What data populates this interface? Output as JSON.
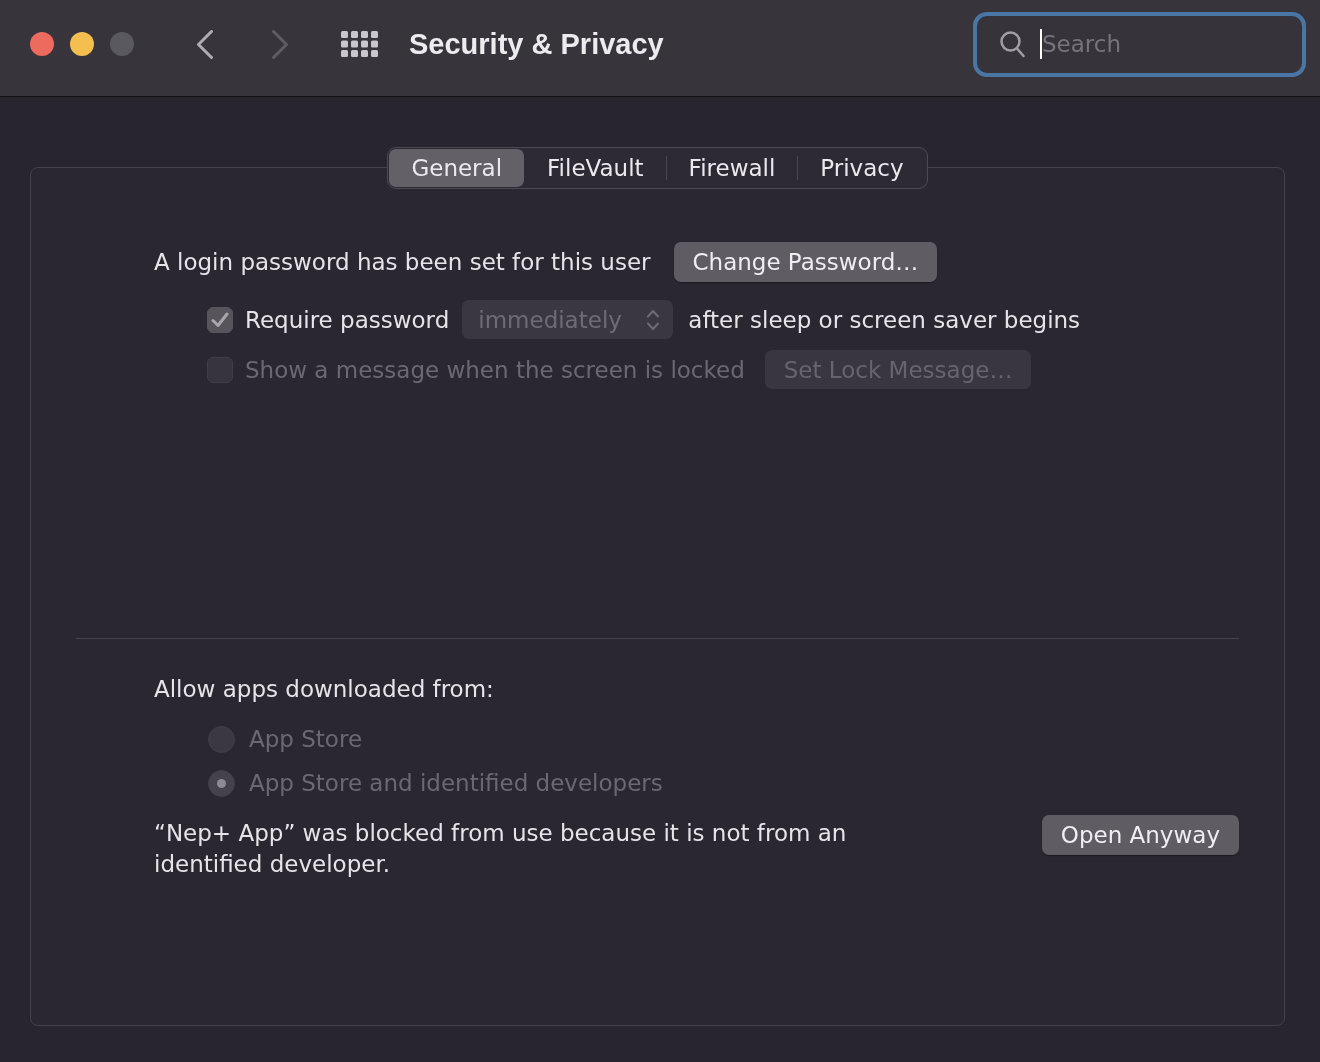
{
  "window": {
    "title": "Security & Privacy",
    "controls": [
      {
        "color": "#ec6a5e"
      },
      {
        "color": "#f5bf4f"
      },
      {
        "color": "#5b5960"
      }
    ]
  },
  "nav": {
    "back": {
      "disabled": false
    },
    "forward": {
      "disabled": true
    }
  },
  "search": {
    "placeholder": "Search",
    "focused": true
  },
  "tabs": [
    {
      "label": "General",
      "selected": true
    },
    {
      "label": "FileVault",
      "selected": false
    },
    {
      "label": "Firewall",
      "selected": false
    },
    {
      "label": "Privacy",
      "selected": false
    }
  ],
  "password": {
    "status": "A login password has been set for this user",
    "button": {
      "label": "Change Password…",
      "disabled": false
    }
  },
  "options": [
    {
      "kind": "popup",
      "label": "Require password",
      "checked": true,
      "disabled": false,
      "popup": {
        "value": "immediately",
        "disabled": true
      },
      "suffix": "after sleep or screen saver begins"
    },
    {
      "kind": "button",
      "label": "Show a message when the screen is locked",
      "checked": false,
      "disabled": true,
      "button": {
        "label": "Set Lock Message…",
        "disabled": true
      }
    }
  ],
  "gatekeeper": {
    "heading": "Allow apps downloaded from:",
    "disabled": true,
    "options": [
      {
        "label": "App Store",
        "selected": false
      },
      {
        "label": "App Store and identified developers",
        "selected": true
      }
    ],
    "message": "“Nep+ App” was blocked from use because it is not from an identified developer.",
    "button": {
      "label": "Open Anyway",
      "disabled": false
    }
  }
}
